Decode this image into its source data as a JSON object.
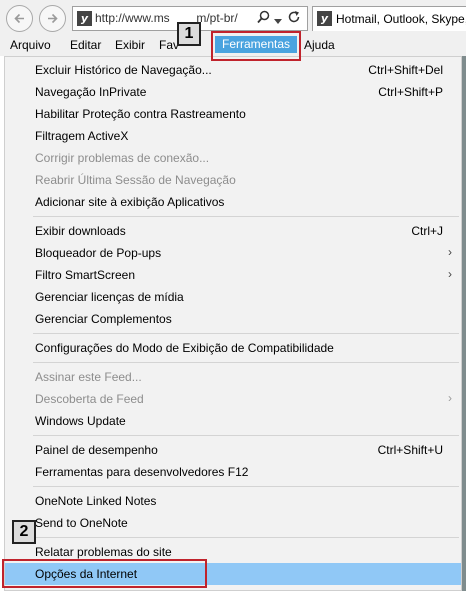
{
  "browser": {
    "address": {
      "url": "http://www.ms        m/pt-br/",
      "search_icon": "search-icon",
      "dropdown_icon": "chevron-down-icon",
      "refresh_icon": "refresh-icon"
    },
    "tab": {
      "title": "Hotmail, Outlook, Skype,"
    }
  },
  "menubar": {
    "items": [
      "Arquivo",
      "Editar",
      "Exibir",
      "Fav",
      "Ferramentas",
      "Ajuda"
    ],
    "active": "Ferramentas"
  },
  "tools_menu": {
    "groups": [
      [
        {
          "label": "Excluir Histórico de Navegação...",
          "shortcut": "Ctrl+Shift+Del"
        },
        {
          "label": "Navegação InPrivate",
          "shortcut": "Ctrl+Shift+P"
        },
        {
          "label": "Habilitar Proteção contra Rastreamento"
        },
        {
          "label": "Filtragem ActiveX"
        },
        {
          "label": "Corrigir problemas de conexão...",
          "disabled": true
        },
        {
          "label": "Reabrir Última Sessão de Navegação",
          "disabled": true
        },
        {
          "label": "Adicionar site à exibição Aplicativos"
        }
      ],
      [
        {
          "label": "Exibir downloads",
          "shortcut": "Ctrl+J"
        },
        {
          "label": "Bloqueador de Pop-ups",
          "submenu": true
        },
        {
          "label": "Filtro SmartScreen",
          "submenu": true
        },
        {
          "label": "Gerenciar licenças de mídia"
        },
        {
          "label": "Gerenciar Complementos"
        }
      ],
      [
        {
          "label": "Configurações do Modo de Exibição de Compatibilidade"
        }
      ],
      [
        {
          "label": "Assinar este Feed...",
          "disabled": true
        },
        {
          "label": "Descoberta de Feed",
          "disabled": true,
          "submenu": true
        },
        {
          "label": "Windows Update"
        }
      ],
      [
        {
          "label": "Painel de desempenho",
          "shortcut": "Ctrl+Shift+U"
        },
        {
          "label": "Ferramentas para desenvolvedores F12"
        }
      ],
      [
        {
          "label": "OneNote Linked Notes"
        },
        {
          "label": "Send to OneNote"
        }
      ],
      [
        {
          "label": "Relatar problemas do site"
        },
        {
          "label": "Opções da Internet",
          "highlighted": true
        }
      ]
    ]
  },
  "callouts": [
    {
      "number": "1",
      "target": "Ferramentas"
    },
    {
      "number": "2",
      "target": "Opções da Internet"
    }
  ],
  "colors": {
    "highlight": "#90c8f6",
    "active_menu": "#4aa3df",
    "callout_border": "#c0232c"
  }
}
